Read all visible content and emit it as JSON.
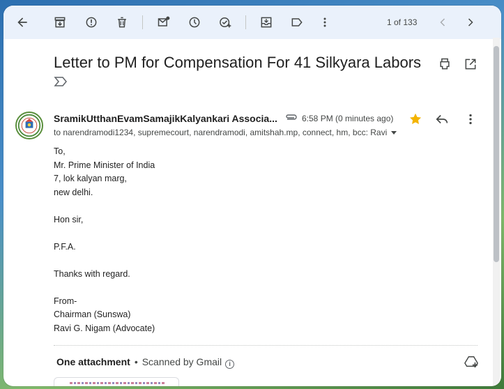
{
  "toolbar": {
    "back_icon": "arrow-left-icon",
    "icons": [
      "archive-icon",
      "report-spam-icon",
      "delete-icon",
      "mark-unread-icon",
      "snooze-icon",
      "add-task-icon",
      "move-to-icon",
      "label-icon",
      "more-vertical-icon"
    ],
    "count": "1 of 133",
    "prev_icon": "chevron-left-icon",
    "next_icon": "chevron-right-icon"
  },
  "email": {
    "subject": "Letter to PM for Compensation For 41 Silkyara Labors",
    "sender": "SramikUtthanEvamSamajikKalyankari Associa...",
    "time": "6:58 PM (0 minutes ago)",
    "recipients": "to narendramodi1234, supremecourt, narendramodi, amitshah.mp, connect, hm, bcc: Ravi",
    "starred": true,
    "body_lines": [
      "To,",
      "Mr. Prime Minister of India",
      "7, lok kalyan marg,",
      "new delhi.",
      "",
      "Hon sir,",
      "",
      "P.F.A.",
      "",
      "Thanks with regard.",
      "",
      "From-",
      "Chairman (Sunswa)",
      "Ravi G. Nigam (Advocate)"
    ]
  },
  "attachments": {
    "title": "One attachment",
    "separator": "•",
    "scan_text": "Scanned by Gmail"
  },
  "colors": {
    "toolbar_bg": "#eaf1fb",
    "star": "#f4b400",
    "text": "#1f1f1f",
    "muted": "#444746"
  }
}
